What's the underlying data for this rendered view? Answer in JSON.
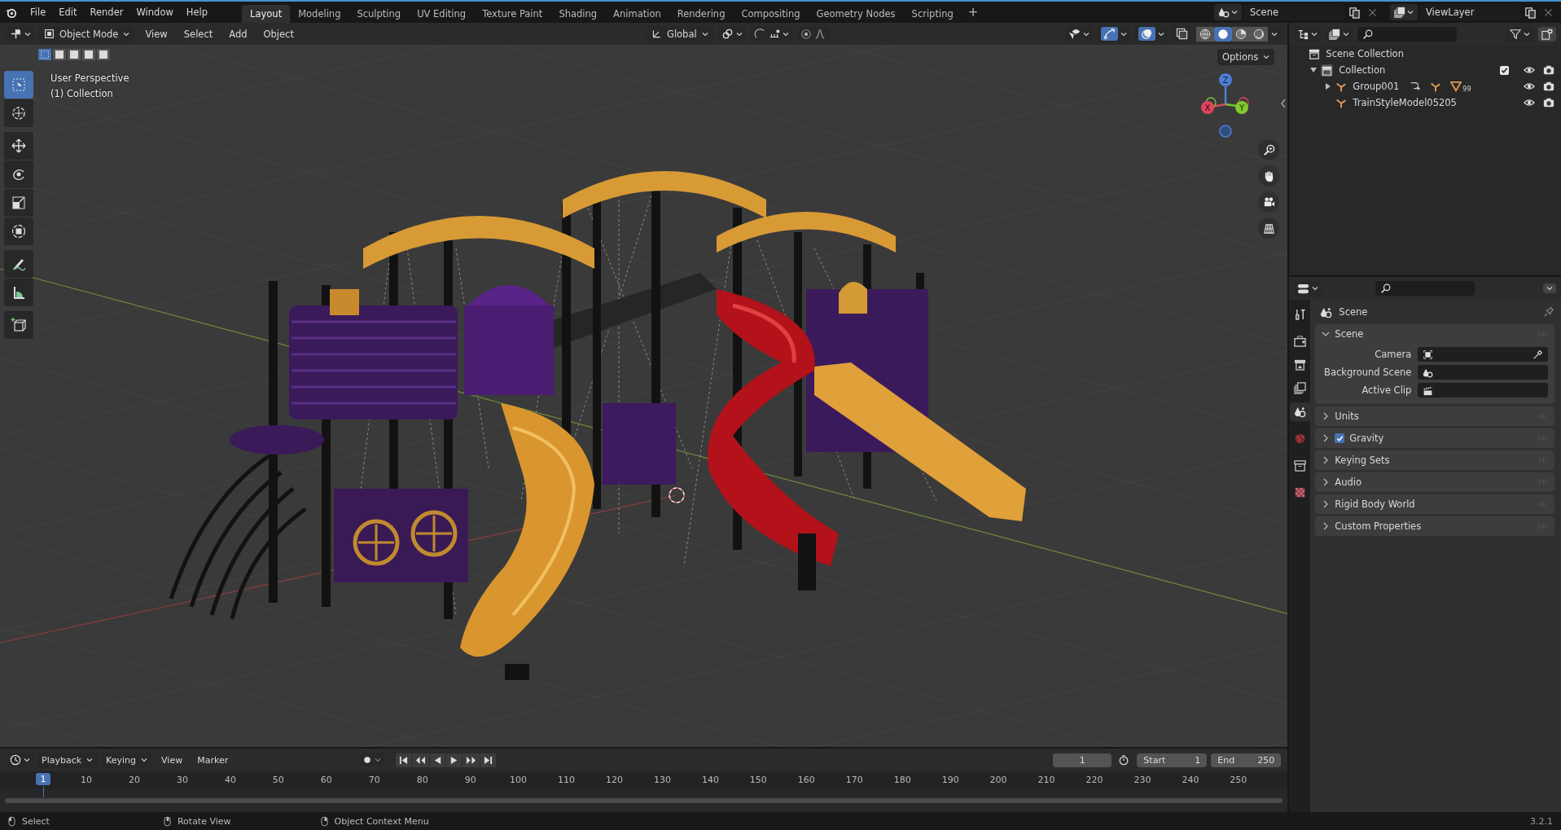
{
  "menu": [
    "File",
    "Edit",
    "Render",
    "Window",
    "Help"
  ],
  "workspaces": [
    {
      "label": "Layout",
      "selected": true
    },
    {
      "label": "Modeling",
      "selected": false
    },
    {
      "label": "Sculpting",
      "selected": false
    },
    {
      "label": "UV Editing",
      "selected": false
    },
    {
      "label": "Texture Paint",
      "selected": false
    },
    {
      "label": "Shading",
      "selected": false
    },
    {
      "label": "Animation",
      "selected": false
    },
    {
      "label": "Rendering",
      "selected": false
    },
    {
      "label": "Compositing",
      "selected": false
    },
    {
      "label": "Geometry Nodes",
      "selected": false
    },
    {
      "label": "Scripting",
      "selected": false
    }
  ],
  "add_workspace": "+",
  "scene_field": "Scene",
  "view_layer_field": "ViewLayer",
  "viewport_header": {
    "mode": "Object Mode",
    "menus": [
      "View",
      "Select",
      "Add",
      "Object"
    ],
    "orientation": "Global",
    "options": "Options"
  },
  "select_modes": [
    {
      "selected": true
    },
    {
      "selected": false
    },
    {
      "selected": false
    },
    {
      "selected": false
    },
    {
      "selected": false
    }
  ],
  "tools": [
    {
      "selected": true
    },
    {
      "selected": false
    },
    {
      "selected": false
    },
    {
      "selected": false
    },
    {
      "selected": false
    },
    {
      "selected": false
    },
    {
      "selected": false
    },
    {
      "selected": false
    },
    {
      "selected": false
    }
  ],
  "viewport": {
    "view_name": "User Perspective",
    "collection_name": "(1) Collection",
    "axes": [
      "X",
      "Y",
      "Z"
    ]
  },
  "outliner": {
    "root": "Scene Collection",
    "tree": [
      {
        "label": "Collection",
        "expanded": true,
        "checked": true,
        "children": [
          {
            "label": "Group001",
            "expanded": false,
            "badge": "99"
          },
          {
            "label": "TrainStyleModel05205"
          }
        ]
      }
    ]
  },
  "properties": {
    "tabs": [
      {
        "selected": false
      },
      {
        "selected": false
      },
      {
        "selected": false
      },
      {
        "selected": false
      },
      {
        "selected": true
      },
      {
        "selected": false
      },
      {
        "selected": false
      },
      {
        "selected": false
      }
    ],
    "context": "Scene",
    "panels": [
      {
        "kind": "fields",
        "title": "Scene",
        "expanded": true,
        "fields": [
          "Camera",
          "Background Scene",
          "Active Clip"
        ]
      },
      {
        "kind": "plain",
        "title": "Units",
        "expanded": false
      },
      {
        "kind": "checkbox",
        "title": "Gravity",
        "expanded": false,
        "checked": true
      },
      {
        "kind": "plain",
        "title": "Keying Sets",
        "expanded": false
      },
      {
        "kind": "plain",
        "title": "Audio",
        "expanded": false
      },
      {
        "kind": "plain",
        "title": "Rigid Body World",
        "expanded": false
      },
      {
        "kind": "plain",
        "title": "Custom Properties",
        "expanded": false
      }
    ]
  },
  "timeline": {
    "menus": [
      {
        "label": "Playback",
        "dropdown": true
      },
      {
        "label": "Keying",
        "dropdown": true
      },
      {
        "label": "View",
        "dropdown": false
      },
      {
        "label": "Marker",
        "dropdown": false
      }
    ],
    "current_frame": "1",
    "start_label": "Start",
    "start": "1",
    "end_label": "End",
    "end": "250",
    "ticks": [
      {
        "label": "1",
        "selected": true
      },
      {
        "label": "10",
        "selected": false
      },
      {
        "label": "20",
        "selected": false
      },
      {
        "label": "30",
        "selected": false
      },
      {
        "label": "40",
        "selected": false
      },
      {
        "label": "50",
        "selected": false
      },
      {
        "label": "60",
        "selected": false
      },
      {
        "label": "70",
        "selected": false
      },
      {
        "label": "80",
        "selected": false
      },
      {
        "label": "90",
        "selected": false
      },
      {
        "label": "100",
        "selected": false
      },
      {
        "label": "110",
        "selected": false
      },
      {
        "label": "120",
        "selected": false
      },
      {
        "label": "130",
        "selected": false
      },
      {
        "label": "140",
        "selected": false
      },
      {
        "label": "150",
        "selected": false
      },
      {
        "label": "160",
        "selected": false
      },
      {
        "label": "170",
        "selected": false
      },
      {
        "label": "180",
        "selected": false
      },
      {
        "label": "190",
        "selected": false
      },
      {
        "label": "200",
        "selected": false
      },
      {
        "label": "210",
        "selected": false
      },
      {
        "label": "220",
        "selected": false
      },
      {
        "label": "230",
        "selected": false
      },
      {
        "label": "240",
        "selected": false
      },
      {
        "label": "250",
        "selected": false
      }
    ]
  },
  "status_bar": {
    "hints": [
      "Select",
      "Rotate View",
      "Object Context Menu"
    ],
    "version": "3.2.1"
  }
}
